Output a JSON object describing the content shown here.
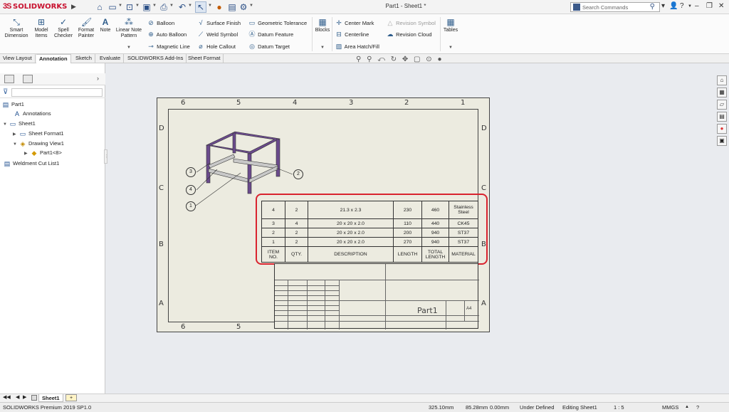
{
  "app": {
    "brand": "SOLIDWORKS",
    "document_title": "Part1 - Sheet1 *"
  },
  "search": {
    "placeholder": "Search Commands"
  },
  "ribbon": {
    "smart_dimension": "Smart Dimension",
    "model_items": "Model Items",
    "spell_checker": "Spell Checker",
    "format_painter": "Format Painter",
    "note": "Note",
    "linear_note_pattern": "Linear Note Pattern",
    "balloon": "Balloon",
    "auto_balloon": "Auto Balloon",
    "magnetic_line": "Magnetic Line",
    "surface_finish": "Surface Finish",
    "weld_symbol": "Weld Symbol",
    "hole_callout": "Hole Callout",
    "geometric_tolerance": "Geometric Tolerance",
    "datum_feature": "Datum Feature",
    "datum_target": "Datum Target",
    "blocks": "Blocks",
    "center_mark": "Center Mark",
    "centerline": "Centerline",
    "area_hatch": "Area Hatch/Fill",
    "revision_symbol": "Revision Symbol",
    "revision_cloud": "Revision Cloud",
    "tables": "Tables"
  },
  "tabs": [
    "View Layout",
    "Annotation",
    "Sketch",
    "Evaluate",
    "SOLIDWORKS Add-Ins",
    "Sheet Format"
  ],
  "active_tab": "Annotation",
  "tree": {
    "root": "Part1",
    "annotations": "Annotations",
    "sheet": "Sheet1",
    "sheet_format": "Sheet Format1",
    "drawing_view": "Drawing View1",
    "part_ref": "Part1<8>",
    "cut_list": "Weldment Cut List1"
  },
  "sheet": {
    "zones_h": [
      "6",
      "5",
      "4",
      "3",
      "2",
      "1"
    ],
    "zones_v": [
      "D",
      "C",
      "B",
      "A"
    ],
    "part_name": "Part1",
    "size": "A4"
  },
  "balloons": [
    "3",
    "4",
    "1",
    "2"
  ],
  "bom": {
    "rows": [
      [
        "4",
        "2",
        "21.3 x 2.3",
        "230",
        "460",
        "Stainless Steel"
      ],
      [
        "3",
        "4",
        "20 x 20 x 2.0",
        "110",
        "440",
        "CK45"
      ],
      [
        "2",
        "2",
        "20 x 20 x 2.0",
        "200",
        "940",
        "ST37"
      ],
      [
        "1",
        "2",
        "20 x 20 x 2.0",
        "270",
        "940",
        "ST37"
      ]
    ],
    "header": [
      "ITEM NO.",
      "QTY.",
      "DESCRIPTION",
      "LENGTH",
      "TOTAL LENGTH",
      "MATERIAL"
    ]
  },
  "colors": {
    "brand": "#c8102e",
    "highlight": "#d9232e",
    "frame_member": "#6a4a8c"
  },
  "sheet_tab": "Sheet1",
  "status": {
    "product": "SOLIDWORKS Premium 2019 SP1.0",
    "x": "325.10mm",
    "y": "85.28mm",
    "z": "0.00mm",
    "state": "Under Defined",
    "editing": "Editing Sheet1",
    "scale": "1 : 5",
    "units": "MMGS"
  }
}
